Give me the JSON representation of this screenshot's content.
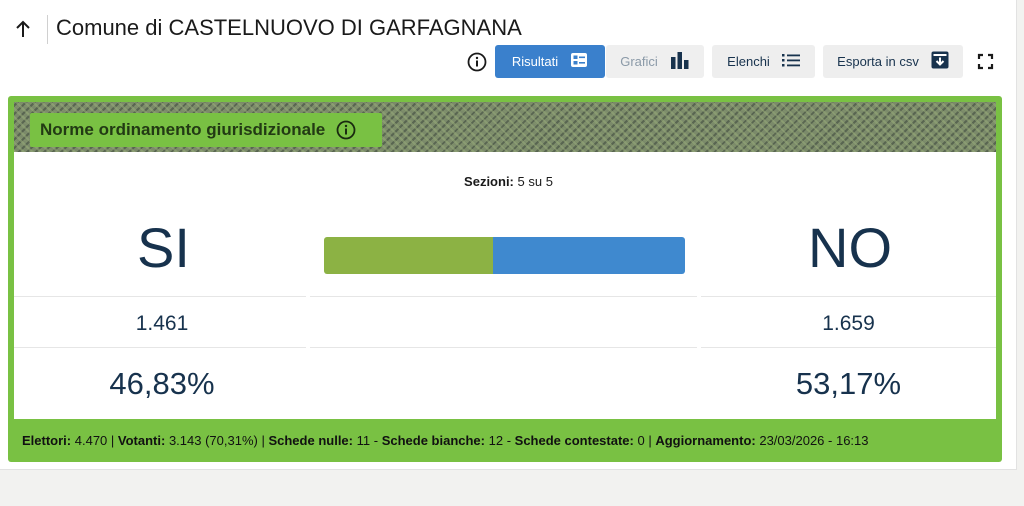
{
  "header": {
    "title": "Comune di CASTELNUOVO DI GARFAGNANA"
  },
  "toolbar": {
    "risultati": "Risultati",
    "grafici": "Grafici",
    "elenchi": "Elenchi",
    "esporta": "Esporta in csv"
  },
  "card": {
    "topic": "Norme ordinamento giurisdizionale",
    "sezioni_label": "Sezioni:",
    "sezioni_value": "5 su 5",
    "yes_label": "SI",
    "no_label": "NO",
    "yes_votes": "1.461",
    "no_votes": "1.659",
    "yes_pct": "46,83%",
    "no_pct": "53,17%",
    "yes_share": 46.83,
    "colors": {
      "yes": "#8cb244",
      "no": "#3f89cf",
      "accent": "#79c143",
      "active_btn": "#3a80cc"
    }
  },
  "footer": {
    "elettori_label": "Elettori:",
    "elettori_value": "4.470",
    "votanti_label": "Votanti:",
    "votanti_value": "3.143 (70,31%)",
    "nulle_label": "Schede nulle:",
    "nulle_value": "11",
    "bianche_label": "Schede bianche:",
    "bianche_value": "12",
    "contestate_label": "Schede contestate:",
    "contestate_value": "0",
    "aggiornamento_label": "Aggiornamento:",
    "aggiornamento_value": "23/03/2026 - 16:13"
  }
}
